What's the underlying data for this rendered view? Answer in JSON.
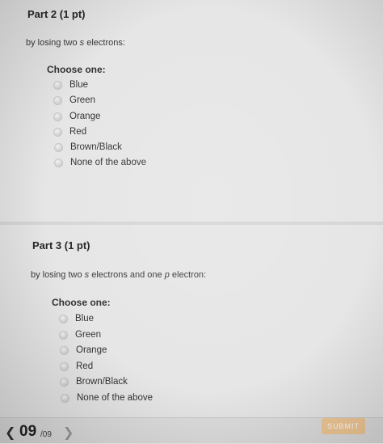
{
  "part2": {
    "title": "Part 2 (1 pt)",
    "prompt_before": "by losing two ",
    "prompt_italic": "s",
    "prompt_after": " electrons:",
    "choose_label": "Choose one:",
    "options": [
      "Blue",
      "Green",
      "Orange",
      "Red",
      "Brown/Black",
      "None of the above"
    ]
  },
  "part3": {
    "title": "Part 3 (1 pt)",
    "prompt_before": "by losing two ",
    "prompt_italic_1": "s",
    "prompt_middle": " electrons and one ",
    "prompt_italic_2": "p",
    "prompt_after": " electron:",
    "choose_label": "Choose one:",
    "options": [
      "Blue",
      "Green",
      "Orange",
      "Red",
      "Brown/Black",
      "None of the above"
    ]
  },
  "footer": {
    "prev_icon": "chevron-left-icon",
    "page_current": "09",
    "page_total": "/09",
    "next_icon": "chevron-right-icon",
    "submit_label": "SUBMIT"
  },
  "colors": {
    "background": "#e6e6e6",
    "submit_bg": "#f1c996"
  }
}
